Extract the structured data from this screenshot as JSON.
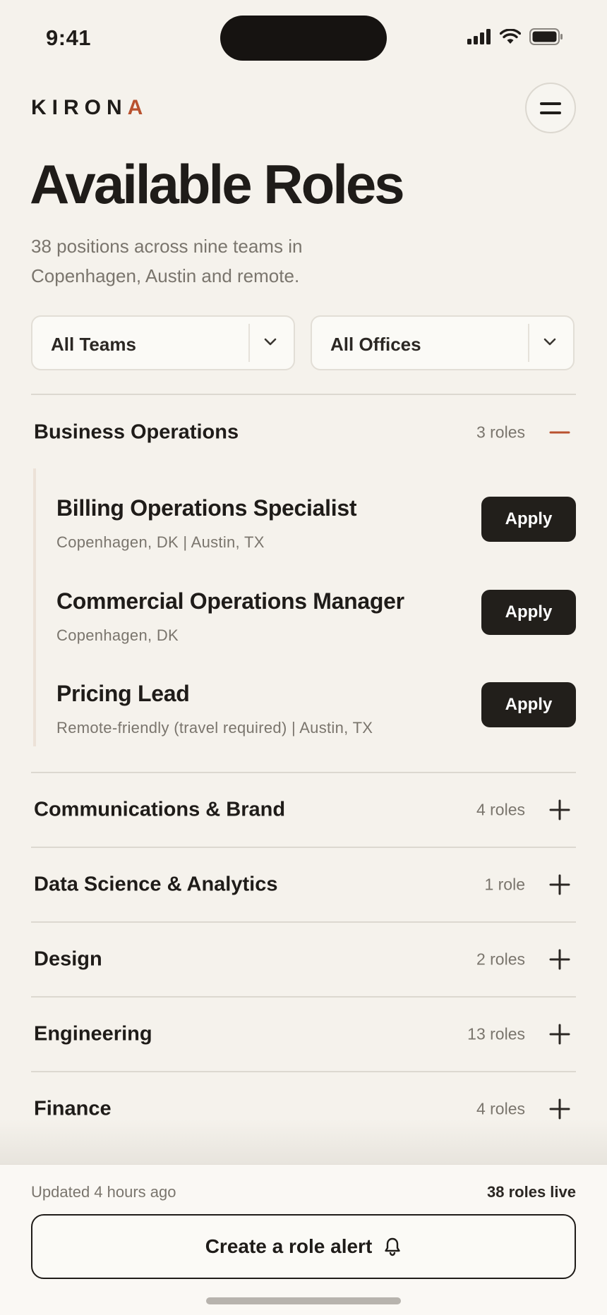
{
  "status_bar": {
    "time": "9:41"
  },
  "brand": {
    "name": "KIRON",
    "accent_letter": "A"
  },
  "header": {
    "title": "Available Roles",
    "subtitle": "38 positions across nine teams in Copenhagen, Austin and remote."
  },
  "filters": {
    "teams": {
      "selected": "All Teams"
    },
    "offices": {
      "selected": "All Offices"
    }
  },
  "sections": [
    {
      "name": "Business Operations",
      "count": "3 roles",
      "expanded": true,
      "roles": [
        {
          "title": "Billing Operations Specialist",
          "locations": "Copenhagen, DK  |  Austin, TX",
          "apply_label": "Apply"
        },
        {
          "title": "Commercial Operations Manager",
          "locations": "Copenhagen, DK",
          "apply_label": "Apply"
        },
        {
          "title": "Pricing Lead",
          "locations": "Remote-friendly (travel required)  |  Austin, TX",
          "apply_label": "Apply"
        }
      ]
    },
    {
      "name": "Communications & Brand",
      "count": "4 roles",
      "expanded": false
    },
    {
      "name": "Data Science & Analytics",
      "count": "1 role",
      "expanded": false
    },
    {
      "name": "Design",
      "count": "2 roles",
      "expanded": false
    },
    {
      "name": "Engineering",
      "count": "13 roles",
      "expanded": false
    },
    {
      "name": "Finance",
      "count": "4 roles",
      "expanded": false
    }
  ],
  "footer": {
    "updated": "Updated 4 hours ago",
    "live_count": "38 roles live",
    "alert_button_label": "Create a role alert"
  },
  "colors": {
    "background": "#f5f2ec",
    "accent": "#b9522f",
    "button_dark": "#221f1b",
    "text_muted": "#7a756d"
  }
}
